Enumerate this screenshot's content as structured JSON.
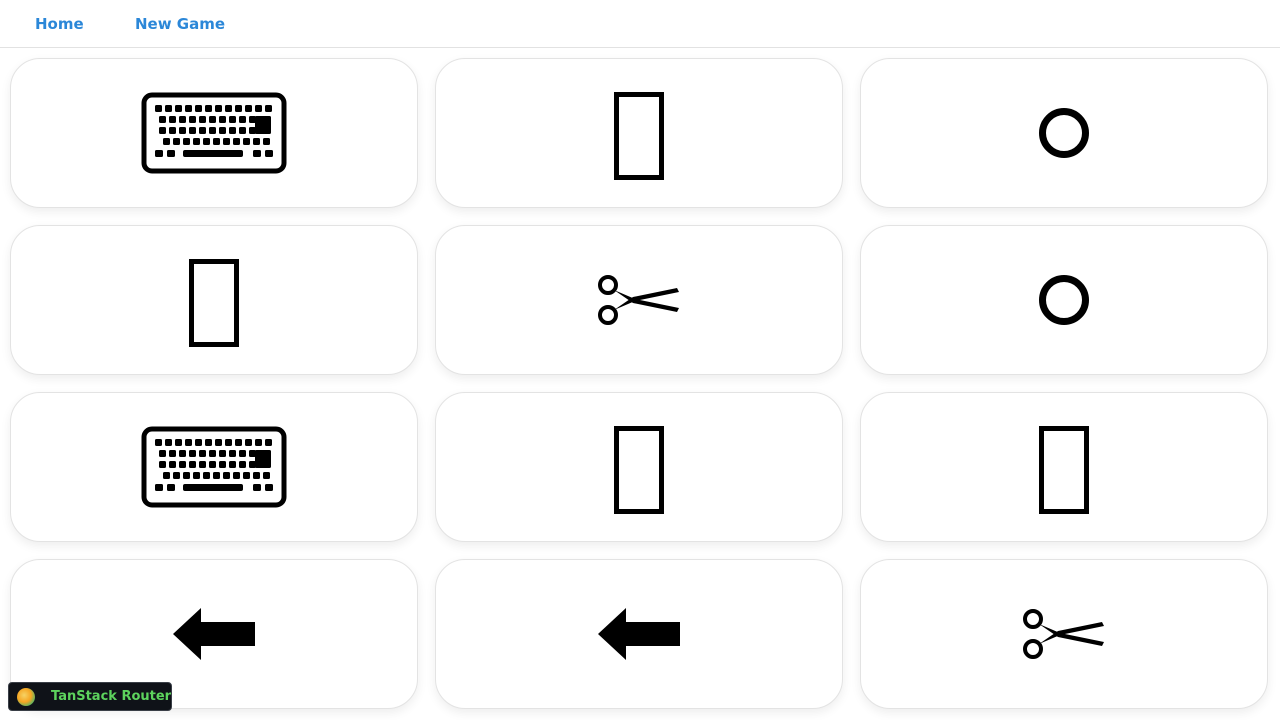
{
  "nav": {
    "home_label": "Home",
    "new_game_label": "New Game"
  },
  "cards": [
    {
      "icon": "keyboard-icon"
    },
    {
      "icon": "missing-glyph-icon"
    },
    {
      "icon": "circle-icon"
    },
    {
      "icon": "missing-glyph-icon"
    },
    {
      "icon": "scissors-icon"
    },
    {
      "icon": "circle-icon"
    },
    {
      "icon": "keyboard-icon"
    },
    {
      "icon": "missing-glyph-icon"
    },
    {
      "icon": "missing-glyph-icon"
    },
    {
      "icon": "left-arrow-icon"
    },
    {
      "icon": "left-arrow-icon"
    },
    {
      "icon": "scissors-icon"
    }
  ],
  "devtools": {
    "label": "TanStack Router"
  },
  "colors": {
    "link": "#2b87d8",
    "devtools_bg": "#0f1218",
    "devtools_text": "#5dd35d"
  }
}
